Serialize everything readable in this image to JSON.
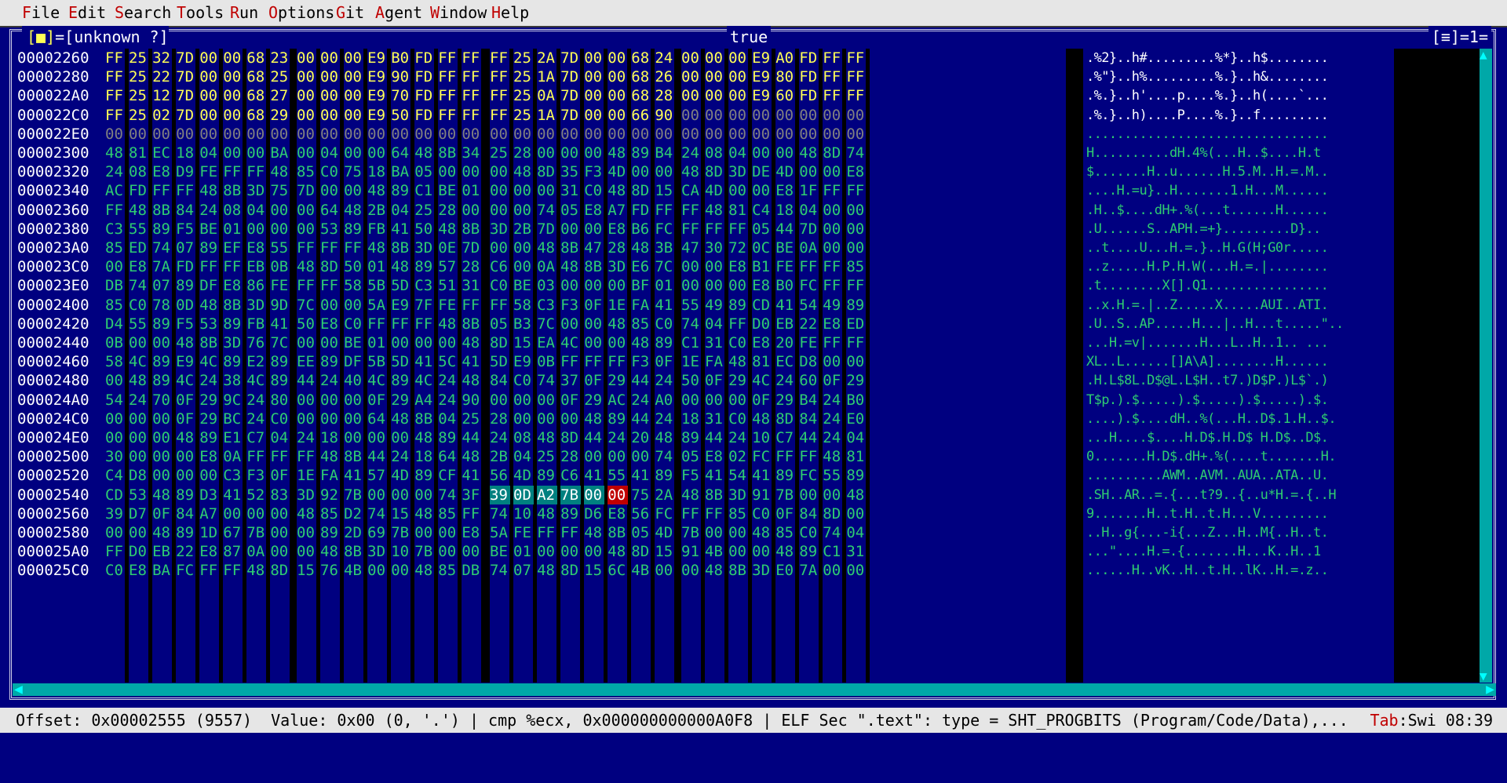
{
  "menu": [
    {
      "hotkey": "F",
      "rest": "ile"
    },
    {
      "hotkey": "E",
      "rest": "dit"
    },
    {
      "hotkey": "S",
      "rest": "earch"
    },
    {
      "hotkey": "T",
      "rest": "ools"
    },
    {
      "hotkey": "R",
      "rest": "un"
    },
    {
      "hotkey": "O",
      "rest": "ptions"
    },
    {
      "hotkey": "G",
      "rest": "it"
    },
    {
      "hotkey": "A",
      "rest": "gent"
    },
    {
      "hotkey": "W",
      "rest": "indow"
    },
    {
      "hotkey": "H",
      "rest": "elp"
    }
  ],
  "window": {
    "close_button": "[■]",
    "name": "=[unknown ?]",
    "title": "true",
    "right_indicator": "[≡]=1="
  },
  "rows": [
    {
      "addr": "00002260",
      "bytes": [
        "FF",
        "25",
        "32",
        "7D",
        "00",
        "00",
        "68",
        "23",
        "00",
        "00",
        "00",
        "E9",
        "B0",
        "FD",
        "FF",
        "FF",
        "FF",
        "25",
        "2A",
        "7D",
        "00",
        "00",
        "68",
        "24",
        "00",
        "00",
        "00",
        "E9",
        "A0",
        "FD",
        "FF",
        "FF"
      ],
      "ascii": ".%2}..h#.........%*}..h$........"
    },
    {
      "addr": "00002280",
      "bytes": [
        "FF",
        "25",
        "22",
        "7D",
        "00",
        "00",
        "68",
        "25",
        "00",
        "00",
        "00",
        "E9",
        "90",
        "FD",
        "FF",
        "FF",
        "FF",
        "25",
        "1A",
        "7D",
        "00",
        "00",
        "68",
        "26",
        "00",
        "00",
        "00",
        "E9",
        "80",
        "FD",
        "FF",
        "FF"
      ],
      "ascii": ".%\"}..h%.........%.}..h&........"
    },
    {
      "addr": "000022A0",
      "bytes": [
        "FF",
        "25",
        "12",
        "7D",
        "00",
        "00",
        "68",
        "27",
        "00",
        "00",
        "00",
        "E9",
        "70",
        "FD",
        "FF",
        "FF",
        "FF",
        "25",
        "0A",
        "7D",
        "00",
        "00",
        "68",
        "28",
        "00",
        "00",
        "00",
        "E9",
        "60",
        "FD",
        "FF",
        "FF"
      ],
      "ascii": ".%.}..h'....p....%.}..h(....`..."
    },
    {
      "addr": "000022C0",
      "bytes": [
        "FF",
        "25",
        "02",
        "7D",
        "00",
        "00",
        "68",
        "29",
        "00",
        "00",
        "00",
        "E9",
        "50",
        "FD",
        "FF",
        "FF",
        "FF",
        "25",
        "1A",
        "7D",
        "00",
        "00",
        "66",
        "90",
        "00",
        "00",
        "00",
        "00",
        "00",
        "00",
        "00",
        "00"
      ],
      "ascii": ".%.}..h)....P....%.}..f........."
    },
    {
      "addr": "000022E0",
      "bytes": [
        "00",
        "00",
        "00",
        "00",
        "00",
        "00",
        "00",
        "00",
        "00",
        "00",
        "00",
        "00",
        "00",
        "00",
        "00",
        "00",
        "00",
        "00",
        "00",
        "00",
        "00",
        "00",
        "00",
        "00",
        "00",
        "00",
        "00",
        "00",
        "00",
        "00",
        "00",
        "00"
      ],
      "ascii": "................................"
    },
    {
      "addr": "00002300",
      "bytes": [
        "48",
        "81",
        "EC",
        "18",
        "04",
        "00",
        "00",
        "BA",
        "00",
        "04",
        "00",
        "00",
        "64",
        "48",
        "8B",
        "34",
        "25",
        "28",
        "00",
        "00",
        "00",
        "48",
        "89",
        "B4",
        "24",
        "08",
        "04",
        "00",
        "00",
        "48",
        "8D",
        "74"
      ],
      "ascii": "H..........dH.4%(...H..$....H.t"
    },
    {
      "addr": "00002320",
      "bytes": [
        "24",
        "08",
        "E8",
        "D9",
        "FE",
        "FF",
        "FF",
        "48",
        "85",
        "C0",
        "75",
        "18",
        "BA",
        "05",
        "00",
        "00",
        "00",
        "48",
        "8D",
        "35",
        "F3",
        "4D",
        "00",
        "00",
        "48",
        "8D",
        "3D",
        "DE",
        "4D",
        "00",
        "00",
        "E8"
      ],
      "ascii": "$.......H..u......H.5.M..H.=.M.."
    },
    {
      "addr": "00002340",
      "bytes": [
        "AC",
        "FD",
        "FF",
        "FF",
        "48",
        "8B",
        "3D",
        "75",
        "7D",
        "00",
        "00",
        "48",
        "89",
        "C1",
        "BE",
        "01",
        "00",
        "00",
        "00",
        "31",
        "C0",
        "48",
        "8D",
        "15",
        "CA",
        "4D",
        "00",
        "00",
        "E8",
        "1F",
        "FF",
        "FF"
      ],
      "ascii": "....H.=u}..H.......1.H...M......"
    },
    {
      "addr": "00002360",
      "bytes": [
        "FF",
        "48",
        "8B",
        "84",
        "24",
        "08",
        "04",
        "00",
        "00",
        "64",
        "48",
        "2B",
        "04",
        "25",
        "28",
        "00",
        "00",
        "00",
        "74",
        "05",
        "E8",
        "A7",
        "FD",
        "FF",
        "FF",
        "48",
        "81",
        "C4",
        "18",
        "04",
        "00",
        "00"
      ],
      "ascii": ".H..$....dH+.%(...t......H......"
    },
    {
      "addr": "00002380",
      "bytes": [
        "C3",
        "55",
        "89",
        "F5",
        "BE",
        "01",
        "00",
        "00",
        "00",
        "53",
        "89",
        "FB",
        "41",
        "50",
        "48",
        "8B",
        "3D",
        "2B",
        "7D",
        "00",
        "00",
        "E8",
        "B6",
        "FC",
        "FF",
        "FF",
        "FF",
        "05",
        "44",
        "7D",
        "00",
        "00"
      ],
      "ascii": ".U......S..APH.=+}.........D}.."
    },
    {
      "addr": "000023A0",
      "bytes": [
        "85",
        "ED",
        "74",
        "07",
        "89",
        "EF",
        "E8",
        "55",
        "FF",
        "FF",
        "FF",
        "48",
        "8B",
        "3D",
        "0E",
        "7D",
        "00",
        "00",
        "48",
        "8B",
        "47",
        "28",
        "48",
        "3B",
        "47",
        "30",
        "72",
        "0C",
        "BE",
        "0A",
        "00",
        "00"
      ],
      "ascii": "..t....U...H.=.}..H.G(H;G0r....."
    },
    {
      "addr": "000023C0",
      "bytes": [
        "00",
        "E8",
        "7A",
        "FD",
        "FF",
        "FF",
        "EB",
        "0B",
        "48",
        "8D",
        "50",
        "01",
        "48",
        "89",
        "57",
        "28",
        "C6",
        "00",
        "0A",
        "48",
        "8B",
        "3D",
        "E6",
        "7C",
        "00",
        "00",
        "E8",
        "B1",
        "FE",
        "FF",
        "FF",
        "85"
      ],
      "ascii": "..z.....H.P.H.W(...H.=.|........"
    },
    {
      "addr": "000023E0",
      "bytes": [
        "DB",
        "74",
        "07",
        "89",
        "DF",
        "E8",
        "86",
        "FE",
        "FF",
        "FF",
        "58",
        "5B",
        "5D",
        "C3",
        "51",
        "31",
        "C0",
        "BE",
        "03",
        "00",
        "00",
        "00",
        "BF",
        "01",
        "00",
        "00",
        "00",
        "E8",
        "B0",
        "FC",
        "FF",
        "FF"
      ],
      "ascii": ".t........X[].Q1................"
    },
    {
      "addr": "00002400",
      "bytes": [
        "85",
        "C0",
        "78",
        "0D",
        "48",
        "8B",
        "3D",
        "9D",
        "7C",
        "00",
        "00",
        "5A",
        "E9",
        "7F",
        "FE",
        "FF",
        "FF",
        "58",
        "C3",
        "F3",
        "0F",
        "1E",
        "FA",
        "41",
        "55",
        "49",
        "89",
        "CD",
        "41",
        "54",
        "49",
        "89"
      ],
      "ascii": "..x.H.=.|..Z.....X.....AUI..ATI."
    },
    {
      "addr": "00002420",
      "bytes": [
        "D4",
        "55",
        "89",
        "F5",
        "53",
        "89",
        "FB",
        "41",
        "50",
        "E8",
        "C0",
        "FF",
        "FF",
        "FF",
        "48",
        "8B",
        "05",
        "B3",
        "7C",
        "00",
        "00",
        "48",
        "85",
        "C0",
        "74",
        "04",
        "FF",
        "D0",
        "EB",
        "22",
        "E8",
        "ED"
      ],
      "ascii": ".U..S..AP.....H...|..H...t.....\".."
    },
    {
      "addr": "00002440",
      "bytes": [
        "0B",
        "00",
        "00",
        "48",
        "8B",
        "3D",
        "76",
        "7C",
        "00",
        "00",
        "BE",
        "01",
        "00",
        "00",
        "00",
        "48",
        "8D",
        "15",
        "EA",
        "4C",
        "00",
        "00",
        "48",
        "89",
        "C1",
        "31",
        "C0",
        "E8",
        "20",
        "FE",
        "FF",
        "FF"
      ],
      "ascii": "...H.=v|.......H...L..H..1.. ..."
    },
    {
      "addr": "00002460",
      "bytes": [
        "58",
        "4C",
        "89",
        "E9",
        "4C",
        "89",
        "E2",
        "89",
        "EE",
        "89",
        "DF",
        "5B",
        "5D",
        "41",
        "5C",
        "41",
        "5D",
        "E9",
        "0B",
        "FF",
        "FF",
        "FF",
        "F3",
        "0F",
        "1E",
        "FA",
        "48",
        "81",
        "EC",
        "D8",
        "00",
        "00"
      ],
      "ascii": "XL..L......[]A\\A]........H......"
    },
    {
      "addr": "00002480",
      "bytes": [
        "00",
        "48",
        "89",
        "4C",
        "24",
        "38",
        "4C",
        "89",
        "44",
        "24",
        "40",
        "4C",
        "89",
        "4C",
        "24",
        "48",
        "84",
        "C0",
        "74",
        "37",
        "0F",
        "29",
        "44",
        "24",
        "50",
        "0F",
        "29",
        "4C",
        "24",
        "60",
        "0F",
        "29"
      ],
      "ascii": ".H.L$8L.D$@L.L$H..t7.)D$P.)L$`.)"
    },
    {
      "addr": "000024A0",
      "bytes": [
        "54",
        "24",
        "70",
        "0F",
        "29",
        "9C",
        "24",
        "80",
        "00",
        "00",
        "00",
        "0F",
        "29",
        "A4",
        "24",
        "90",
        "00",
        "00",
        "00",
        "0F",
        "29",
        "AC",
        "24",
        "A0",
        "00",
        "00",
        "00",
        "0F",
        "29",
        "B4",
        "24",
        "B0"
      ],
      "ascii": "T$p.).$.....).$.....).$.....).$."
    },
    {
      "addr": "000024C0",
      "bytes": [
        "00",
        "00",
        "00",
        "0F",
        "29",
        "BC",
        "24",
        "C0",
        "00",
        "00",
        "00",
        "64",
        "48",
        "8B",
        "04",
        "25",
        "28",
        "00",
        "00",
        "00",
        "48",
        "89",
        "44",
        "24",
        "18",
        "31",
        "C0",
        "48",
        "8D",
        "84",
        "24",
        "E0"
      ],
      "ascii": "....).$....dH..%(...H..D$.1.H..$."
    },
    {
      "addr": "000024E0",
      "bytes": [
        "00",
        "00",
        "00",
        "48",
        "89",
        "E1",
        "C7",
        "04",
        "24",
        "18",
        "00",
        "00",
        "00",
        "48",
        "89",
        "44",
        "24",
        "08",
        "48",
        "8D",
        "44",
        "24",
        "20",
        "48",
        "89",
        "44",
        "24",
        "10",
        "C7",
        "44",
        "24",
        "04"
      ],
      "ascii": "...H....$....H.D$.H.D$ H.D$..D$."
    },
    {
      "addr": "00002500",
      "bytes": [
        "30",
        "00",
        "00",
        "00",
        "E8",
        "0A",
        "FF",
        "FF",
        "FF",
        "48",
        "8B",
        "44",
        "24",
        "18",
        "64",
        "48",
        "2B",
        "04",
        "25",
        "28",
        "00",
        "00",
        "00",
        "74",
        "05",
        "E8",
        "02",
        "FC",
        "FF",
        "FF",
        "48",
        "81"
      ],
      "ascii": "0.......H.D$.dH+.%(....t.......H."
    },
    {
      "addr": "00002520",
      "bytes": [
        "C4",
        "D8",
        "00",
        "00",
        "00",
        "C3",
        "F3",
        "0F",
        "1E",
        "FA",
        "41",
        "57",
        "4D",
        "89",
        "CF",
        "41",
        "56",
        "4D",
        "89",
        "C6",
        "41",
        "55",
        "41",
        "89",
        "F5",
        "41",
        "54",
        "41",
        "89",
        "FC",
        "55",
        "89"
      ],
      "ascii": "..........AWM..AVM..AUA..ATA..U."
    },
    {
      "addr": "00002540",
      "bytes": [
        "CD",
        "53",
        "48",
        "89",
        "D3",
        "41",
        "52",
        "83",
        "3D",
        "92",
        "7B",
        "00",
        "00",
        "00",
        "74",
        "3F",
        "39",
        "0D",
        "A2",
        "7B",
        "00",
        "00",
        "75",
        "2A",
        "48",
        "8B",
        "3D",
        "91",
        "7B",
        "00",
        "00",
        "48"
      ],
      "ascii": ".SH..AR..=.{...t?9..{..u*H.=.{..H"
    },
    {
      "addr": "00002560",
      "bytes": [
        "39",
        "D7",
        "0F",
        "84",
        "A7",
        "00",
        "00",
        "00",
        "48",
        "85",
        "D2",
        "74",
        "15",
        "48",
        "85",
        "FF",
        "74",
        "10",
        "48",
        "89",
        "D6",
        "E8",
        "56",
        "FC",
        "FF",
        "FF",
        "85",
        "C0",
        "0F",
        "84",
        "8D",
        "00"
      ],
      "ascii": "9.......H..t.H..t.H...V........."
    },
    {
      "addr": "00002580",
      "bytes": [
        "00",
        "00",
        "48",
        "89",
        "1D",
        "67",
        "7B",
        "00",
        "00",
        "89",
        "2D",
        "69",
        "7B",
        "00",
        "00",
        "E8",
        "5A",
        "FE",
        "FF",
        "FF",
        "48",
        "8B",
        "05",
        "4D",
        "7B",
        "00",
        "00",
        "48",
        "85",
        "C0",
        "74",
        "04"
      ],
      "ascii": "..H..g{...-i{...Z...H..M{..H..t."
    },
    {
      "addr": "000025A0",
      "bytes": [
        "FF",
        "D0",
        "EB",
        "22",
        "E8",
        "87",
        "0A",
        "00",
        "00",
        "48",
        "8B",
        "3D",
        "10",
        "7B",
        "00",
        "00",
        "BE",
        "01",
        "00",
        "00",
        "00",
        "48",
        "8D",
        "15",
        "91",
        "4B",
        "00",
        "00",
        "48",
        "89",
        "C1",
        "31"
      ],
      "ascii": "...\"....H.=.{.......H...K..H..1"
    },
    {
      "addr": "000025C0",
      "bytes": [
        "C0",
        "E8",
        "BA",
        "FC",
        "FF",
        "FF",
        "48",
        "8D",
        "15",
        "76",
        "4B",
        "00",
        "00",
        "48",
        "85",
        "DB",
        "74",
        "07",
        "48",
        "8D",
        "15",
        "6C",
        "4B",
        "00",
        "00",
        "48",
        "8B",
        "3D",
        "E0",
        "7A",
        "00",
        "00"
      ],
      "ascii": "......H..vK..H..t.H..lK..H.=.z.."
    }
  ],
  "selection": {
    "row": 23,
    "from": 16,
    "to": 20,
    "cursor": 21
  },
  "status": {
    "text": "Offset: 0x00002555 (9557)  Value: 0x00 (0, '.') | cmp %ecx, 0x000000000000A0F8 | ELF Sec \".text\": type = SHT_PROGBITS (Program/Code/Data),...",
    "tab_label": "Tab",
    "tab_mode": ":Swi 08:39"
  },
  "colors": {
    "background": "#000080",
    "byte_text": "#2ecc71",
    "selection": "#008080",
    "cursor": "#c00000"
  }
}
